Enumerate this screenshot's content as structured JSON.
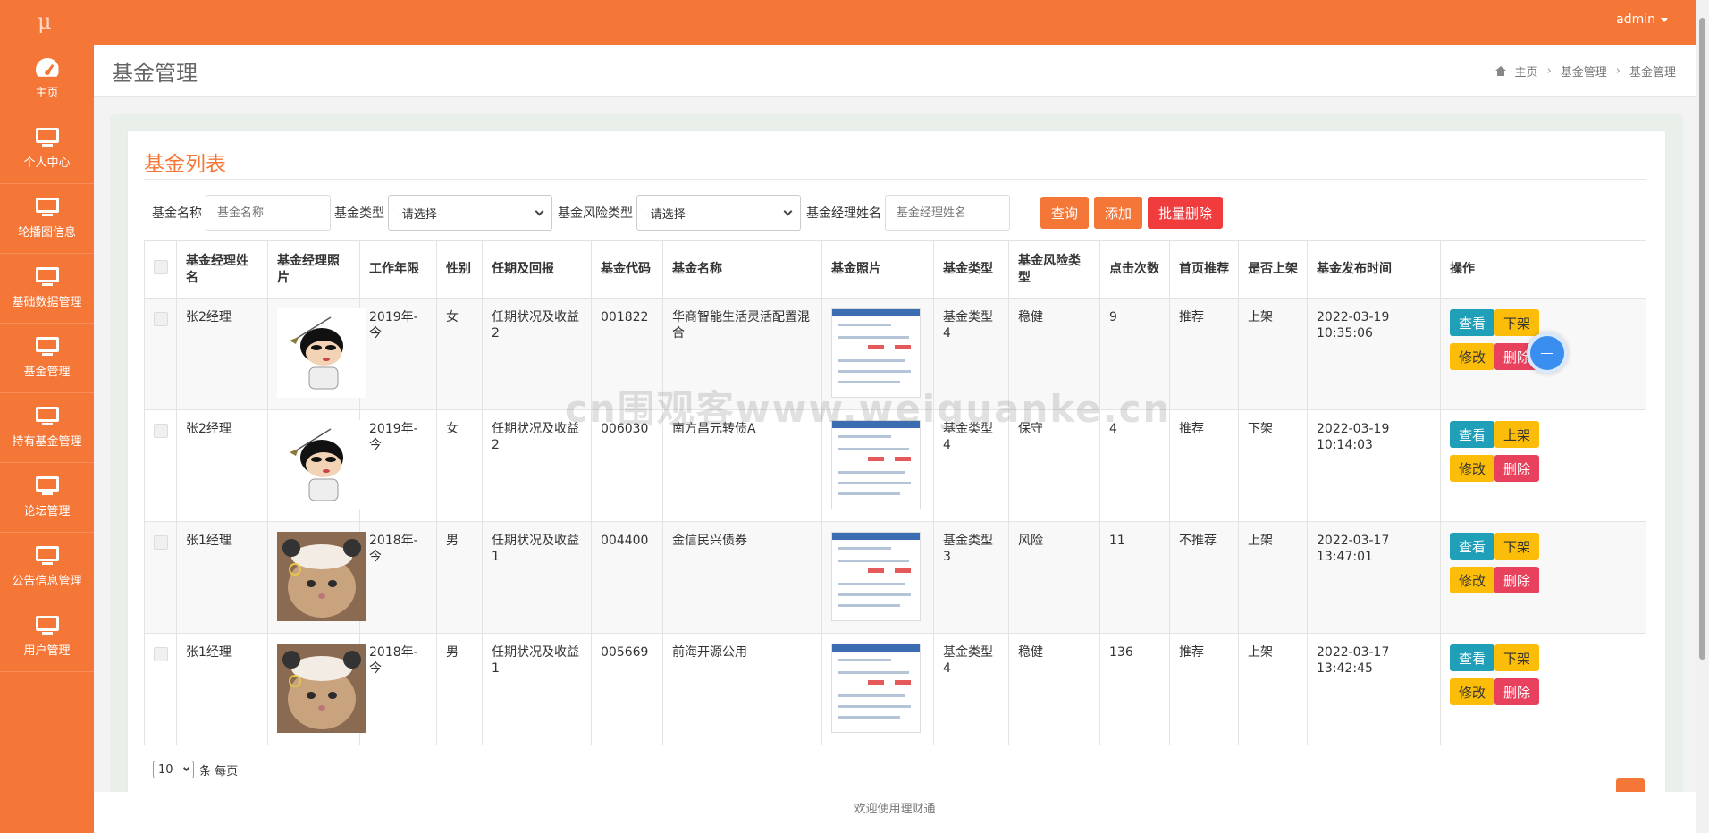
{
  "app": {
    "logo": "μ",
    "user": "admin"
  },
  "sidebar": {
    "items": [
      {
        "label": "主页",
        "icon": "dashboard-icon"
      },
      {
        "label": "个人中心",
        "icon": "monitor-icon"
      },
      {
        "label": "轮播图信息",
        "icon": "monitor-icon"
      },
      {
        "label": "基础数据管理",
        "icon": "monitor-icon"
      },
      {
        "label": "基金管理",
        "icon": "monitor-icon"
      },
      {
        "label": "持有基金管理",
        "icon": "monitor-icon"
      },
      {
        "label": "论坛管理",
        "icon": "monitor-icon"
      },
      {
        "label": "公告信息管理",
        "icon": "monitor-icon"
      },
      {
        "label": "用户管理",
        "icon": "monitor-icon"
      }
    ]
  },
  "header": {
    "title": "基金管理",
    "breadcrumb": [
      "主页",
      "基金管理",
      "基金管理"
    ]
  },
  "list": {
    "title": "基金列表",
    "filters": {
      "name_label": "基金名称",
      "name_placeholder": "基金名称",
      "type_label": "基金类型",
      "type_value": "-请选择-",
      "risk_label": "基金风险类型",
      "risk_value": "-请选择-",
      "manager_label": "基金经理姓名",
      "manager_placeholder": "基金经理姓名",
      "query": "查询",
      "add": "添加",
      "batch_delete": "批量删除"
    },
    "columns": [
      "基金经理姓名",
      "基金经理照片",
      "工作年限",
      "性别",
      "任期及回报",
      "基金代码",
      "基金名称",
      "基金照片",
      "基金类型",
      "基金风险类型",
      "点击次数",
      "首页推荐",
      "是否上架",
      "基金发布时间",
      "操作"
    ],
    "rows": [
      {
        "manager": "张2经理",
        "avatar": "cartoon-boy",
        "years": "2019年-今",
        "gender": "女",
        "tenure": "任期状况及收益2",
        "code": "001822",
        "name": "华商智能生活灵活配置混合",
        "type": "基金类型4",
        "risk": "稳健",
        "clicks": "9",
        "recommend": "推荐",
        "listed": "上架",
        "published": "2022-03-19 10:35:06",
        "toggle": "下架"
      },
      {
        "manager": "张2经理",
        "avatar": "cartoon-boy",
        "years": "2019年-今",
        "gender": "女",
        "tenure": "任期状况及收益2",
        "code": "006030",
        "name": "南方昌元转债A",
        "type": "基金类型4",
        "risk": "保守",
        "clicks": "4",
        "recommend": "推荐",
        "listed": "下架",
        "published": "2022-03-19 10:14:03",
        "toggle": "上架"
      },
      {
        "manager": "张1经理",
        "avatar": "cat",
        "years": "2018年-今",
        "gender": "男",
        "tenure": "任期状况及收益1",
        "code": "004400",
        "name": "金信民兴债券",
        "type": "基金类型3",
        "risk": "风险",
        "clicks": "11",
        "recommend": "不推荐",
        "listed": "上架",
        "published": "2022-03-17 13:47:01",
        "toggle": "下架"
      },
      {
        "manager": "张1经理",
        "avatar": "cat",
        "years": "2018年-今",
        "gender": "男",
        "tenure": "任期状况及收益1",
        "code": "005669",
        "name": "前海开源公用",
        "type": "基金类型4",
        "risk": "稳健",
        "clicks": "136",
        "recommend": "推荐",
        "listed": "上架",
        "published": "2022-03-17 13:42:45",
        "toggle": "下架"
      }
    ],
    "actions": {
      "view": "查看",
      "edit": "修改",
      "delete": "删除"
    },
    "pager": {
      "size": "10",
      "suffix": "条 每页"
    }
  },
  "footer": {
    "text": "欢迎使用理财通"
  },
  "watermark": "cn围观客www.weiguanke.cn",
  "colors": {
    "accent": "#f47738",
    "view": "#1f9fb8",
    "toggle": "#fbbd08",
    "delete": "#e8415e",
    "batch_delete": "#f03c3c"
  }
}
